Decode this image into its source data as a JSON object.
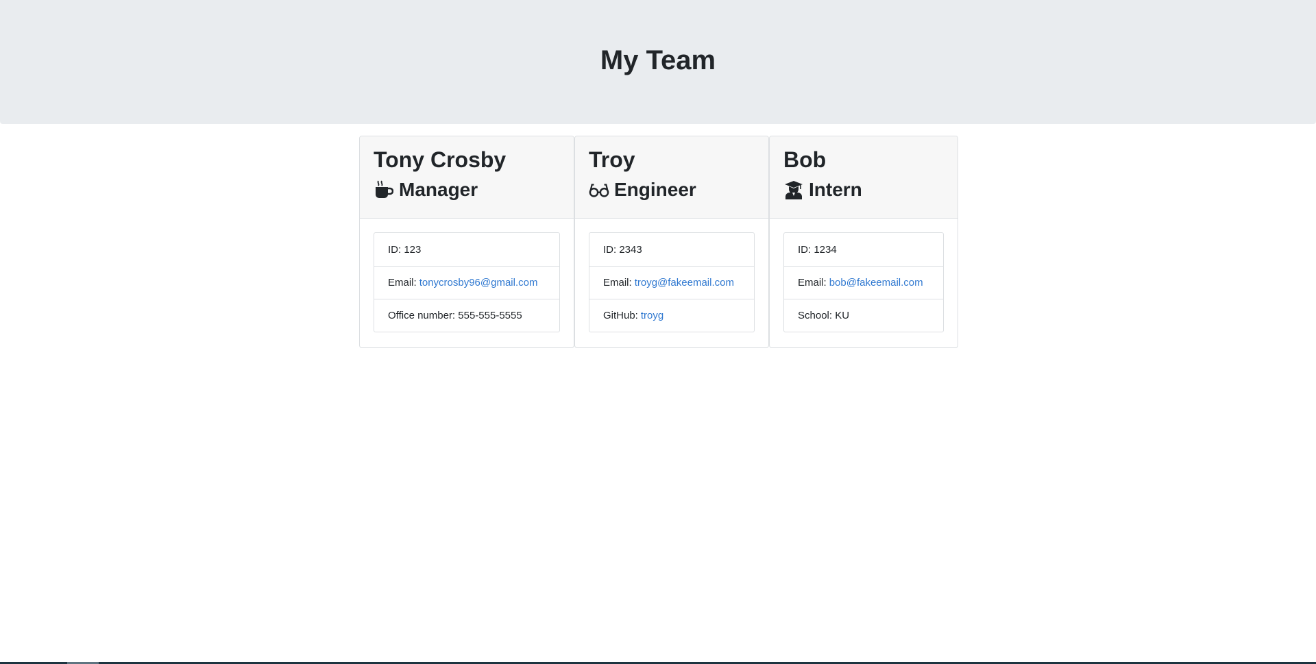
{
  "header": {
    "title": "My Team"
  },
  "team": [
    {
      "name": "Tony Crosby",
      "role": "Manager",
      "icon": "coffee-mug-icon",
      "id_label": "ID:",
      "id_value": "123",
      "email_label": "Email:",
      "email": "tonycrosby96@gmail.com",
      "extra_label": "Office number:",
      "extra_value": "555-555-5555"
    },
    {
      "name": "Troy",
      "role": "Engineer",
      "icon": "glasses-icon",
      "id_label": "ID:",
      "id_value": "2343",
      "email_label": "Email:",
      "email": "troyg@fakeemail.com",
      "extra_label": "GitHub:",
      "extra_value": "troyg"
    },
    {
      "name": "Bob",
      "role": "Intern",
      "icon": "graduate-icon",
      "id_label": "ID:",
      "id_value": "1234",
      "email_label": "Email:",
      "email": "bob@fakeemail.com",
      "extra_label": "School:",
      "extra_value": "KU"
    }
  ],
  "colors": {
    "header_bg": "#e9ecef",
    "link": "#2f78d0",
    "text": "#212529"
  }
}
